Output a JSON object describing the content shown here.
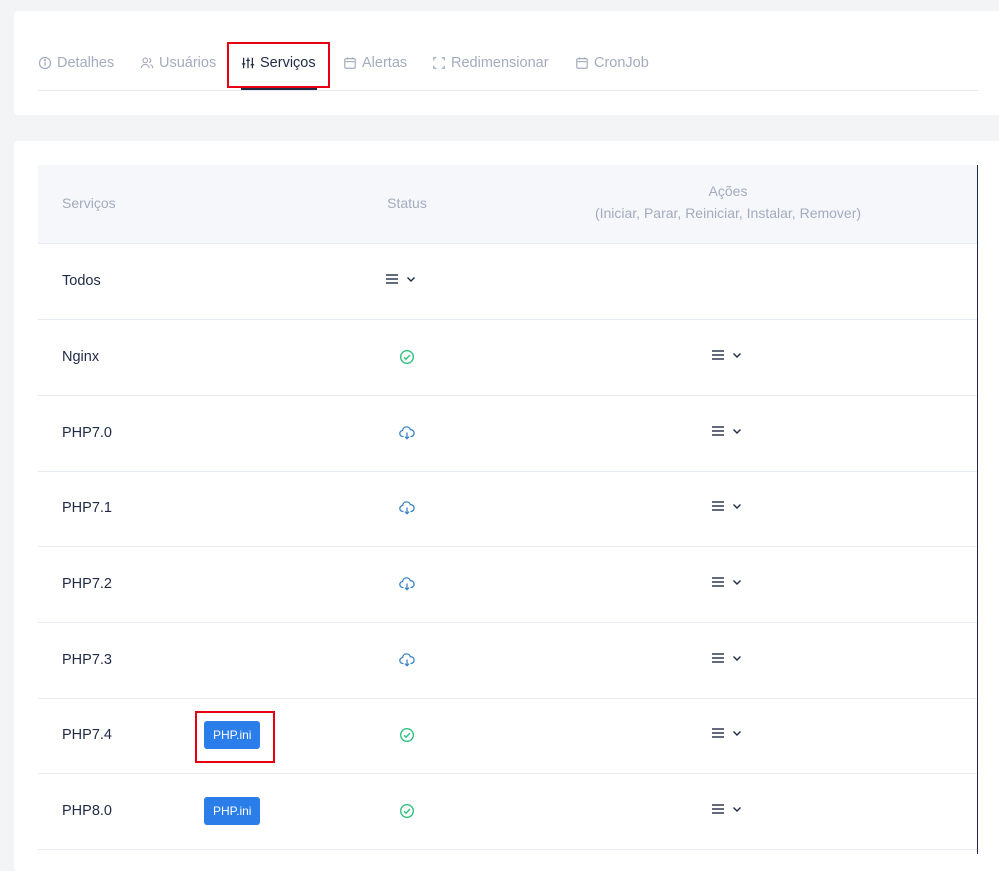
{
  "tabs": [
    {
      "label": "Detalhes",
      "icon": "info-icon"
    },
    {
      "label": "Usuários",
      "icon": "users-icon"
    },
    {
      "label": "Serviços",
      "icon": "sliders-icon",
      "active": true
    },
    {
      "label": "Alertas",
      "icon": "calendar-icon"
    },
    {
      "label": "Redimensionar",
      "icon": "resize-icon"
    },
    {
      "label": "CronJob",
      "icon": "calendar-icon"
    }
  ],
  "table": {
    "headers": {
      "services": "Serviços",
      "status": "Status",
      "actions_title": "Ações",
      "actions_subtitle": "(Iniciar, Parar, Reiniciar, Instalar, Remover)"
    },
    "rows": [
      {
        "name": "Todos",
        "status": "menu",
        "action": "none"
      },
      {
        "name": "Nginx",
        "status": "installed",
        "action": "menu"
      },
      {
        "name": "PHP7.0",
        "status": "download",
        "action": "menu"
      },
      {
        "name": "PHP7.1",
        "status": "download",
        "action": "menu"
      },
      {
        "name": "PHP7.2",
        "status": "download",
        "action": "menu"
      },
      {
        "name": "PHP7.3",
        "status": "download",
        "action": "menu"
      },
      {
        "name": "PHP7.4",
        "status": "installed",
        "action": "menu",
        "extra_button": "PHP.ini"
      },
      {
        "name": "PHP8.0",
        "status": "installed",
        "action": "menu",
        "extra_button": "PHP.ini"
      }
    ]
  },
  "colors": {
    "accent": "#2b7de9",
    "installed": "#2ec27e",
    "download": "#3b82c4",
    "highlight": "#e60012",
    "text": "#1f2a44",
    "muted": "#a3acbd"
  }
}
